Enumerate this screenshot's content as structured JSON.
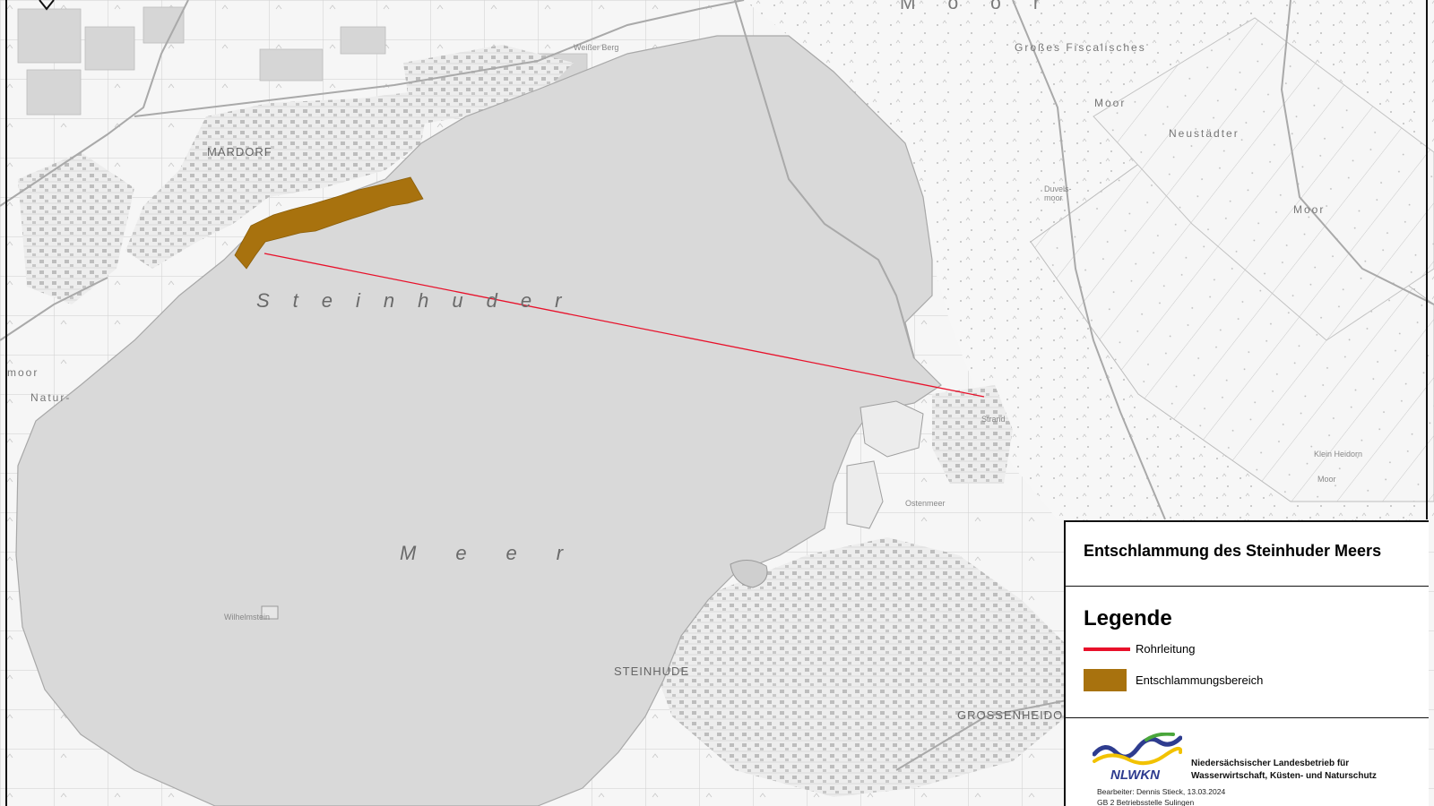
{
  "map": {
    "water_labels": {
      "lake_line1": "Steinhuder",
      "lake_line2": "Meer"
    },
    "place_labels": {
      "mardorf": "MARDORF",
      "steinhude": "STEINHUDE",
      "grossenheidorn": "GROSSENHEIDORN",
      "moor_top": "Moor",
      "grosses_fiscalisches": "Großes Fiscalisches",
      "moor_a": "Moor",
      "neustaedter": "Neustädter",
      "moor_b": "Moor",
      "natur": "Natur-",
      "moor_left": "moor",
      "weisser_berg": "Weißer Berg",
      "strand": "Strand",
      "kleinheidorn": "Klein Heidorn",
      "moor_c": "Moor",
      "duvels_moor": "Duvels-moor",
      "ostenmeer": "Ostenmeer",
      "wilhelmstein": "Wilhelmstein"
    },
    "colors": {
      "water": "#d9d9d9",
      "land": "#f1f1f1",
      "pipeline": "#e8102a",
      "dredging_area": "#a8720e"
    }
  },
  "panel": {
    "title": "Entschlammung des Steinhuder Meers",
    "legend": {
      "heading": "Legende",
      "items": [
        {
          "label": "Rohrleitung",
          "symbol": "line",
          "color": "#e8102a"
        },
        {
          "label": "Entschlammungsbereich",
          "symbol": "fill",
          "color": "#a8720e"
        }
      ]
    },
    "organization": {
      "logo_text": "NLWKN",
      "name_line1": "Niedersächsischer Landesbetrieb für",
      "name_line2": "Wasserwirtschaft, Küsten- und Naturschutz",
      "editor_line1": "Bearbeiter: Dennis Stieck, 13.03.2024",
      "editor_line2": "GB 2 Betriebsstelle Sulingen"
    }
  }
}
